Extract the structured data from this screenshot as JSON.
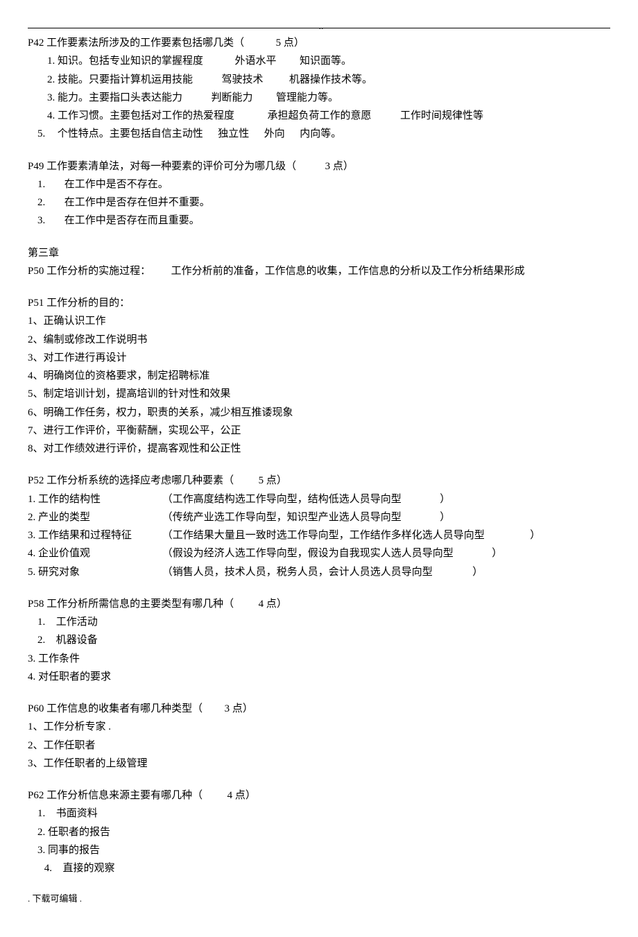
{
  "top_dots": "..",
  "P42": {
    "title_pre": "P42 工作要素法所涉及的工作要素包括哪几类（",
    "title_pts": "5 点）",
    "items": [
      {
        "n": "1.",
        "a": "知识。包括专业知识的掌握程度",
        "b": "外语水平",
        "c": "知识面等。"
      },
      {
        "n": "2.",
        "a": "技能。只要指计算机运用技能",
        "b": "驾驶技术",
        "c": "机器操作技术等。"
      },
      {
        "n": "3.",
        "a": "能力。主要指口头表达能力",
        "b": "判断能力",
        "c": "管理能力等。"
      },
      {
        "n": "4.",
        "a": "工作习惯。主要包括对工作的热爱程度",
        "b": "承担超负荷工作的意愿",
        "c": "工作时间规律性等"
      },
      {
        "n": "5.",
        "a": "个性特点。主要包括自信主动性",
        "b": "独立性",
        "c": "外向",
        "d": "内向等。"
      }
    ]
  },
  "P49": {
    "title_pre": "P49 工作要素清单法，对每一种要素的评价可分为哪几级（",
    "title_pts": "3 点）",
    "items": [
      {
        "n": "1.",
        "t": "在工作中是否不存在。"
      },
      {
        "n": "2.",
        "t": "在工作中是否存在但并不重要。"
      },
      {
        "n": "3.",
        "t": "在工作中是否存在而且重要。"
      }
    ]
  },
  "ch3": "第三章",
  "P50": {
    "a": "P50 工作分析的实施过程：",
    "b": "工作分析前的准备，工作信息的收集，工作信息的分析以及工作分析结果形成"
  },
  "P51": {
    "title": "P51 工作分析的目的：",
    "items": [
      "1、正确认识工作",
      "2、编制或修改工作说明书",
      "3、对工作进行再设计",
      "4、明确岗位的资格要求，制定招聘标准",
      "5、制定培训计划，提高培训的针对性和效果",
      "6、明确工作任务，权力，职责的关系，减少相互推诿现象",
      "7、进行工作评价，平衡薪酬，实现公平，公正",
      "8、对工作绩效进行评价，提高客观性和公正性"
    ]
  },
  "P52": {
    "title_pre": "P52 工作分析系统的选择应考虑哪几种要素（",
    "title_pts": "5 点）",
    "rows": [
      {
        "l": "1. 工作的结构性",
        "e": "（工作高度结构选工作导向型，结构低选人员导向型",
        "p": "）"
      },
      {
        "l": "2. 产业的类型",
        "e": "（传统产业选工作导向型，知识型产业选人员导向型",
        "p": "）"
      },
      {
        "l": "3. 工作结果和过程特征",
        "e": "（工作结果大量且一致时选工作导向型，工作结作多样化选人员导向型",
        "p": "）"
      },
      {
        "l": "4. 企业价值观",
        "e": "（假设为经济人选工作导向型，假设为自我现实人选人员导向型",
        "p": "）"
      },
      {
        "l": "5. 研究对象",
        "e": "（销售人员，技术人员，税务人员，会计人员选人员导向型",
        "p": "）"
      }
    ]
  },
  "P58": {
    "title_pre": "P58 工作分析所需信息的主要类型有哪几种（",
    "title_pts": "4 点）",
    "items": [
      {
        "n": "1.",
        "t": "工作活动",
        "ind": true
      },
      {
        "n": "2.",
        "t": "机器设备",
        "ind": true
      },
      {
        "n": "3.",
        "t": "工作条件",
        "ind": false
      },
      {
        "n": "4.",
        "t": "对任职者的要求",
        "ind": false
      }
    ]
  },
  "P60": {
    "title_pre": "P60 工作信息的收集者有哪几种类型（",
    "title_pts": "3 点）",
    "items": [
      "1、工作分析专家  .",
      "2、工作任职者",
      "3、工作任职者的上级管理"
    ]
  },
  "P62": {
    "title_pre": "P62 工作分析信息来源主要有哪几种（",
    "title_pts": "4 点）",
    "items": [
      {
        "n": "1.",
        "t": "书面资料"
      },
      {
        "n": "2.",
        "t": "任职者的报告"
      },
      {
        "n": "3.",
        "t": "同事的报告"
      },
      {
        "n": "4.",
        "t": "直接的观察"
      }
    ]
  },
  "footer": ". 下载可编辑 ."
}
